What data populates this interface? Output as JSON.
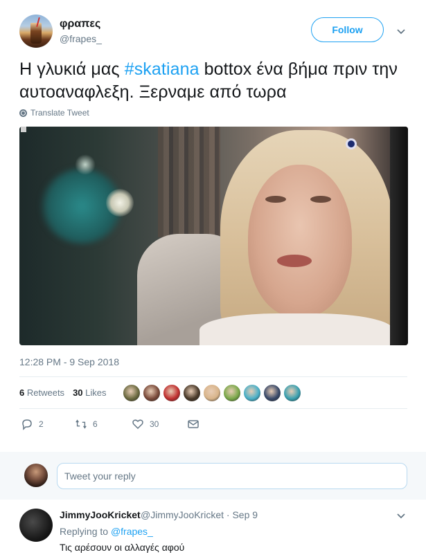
{
  "tweet": {
    "display_name": "φραπες",
    "handle": "@frapes_",
    "follow_label": "Follow",
    "text_before": "Η γλυκιά μας ",
    "hashtag": "#skatiana",
    "text_after": " bottox ένα βήμα πριν την αυτοαναφλεξη. Ξερναμε από τωρα",
    "translate_label": "Translate Tweet",
    "timestamp": "12:28 PM - 9 Sep 2018",
    "retweets_count": "6",
    "retweets_label": "Retweets",
    "likes_count": "30",
    "likes_label": "Likes",
    "reply_count": "2",
    "retweet_action_count": "6",
    "like_action_count": "30"
  },
  "liker_avatar_colors": [
    "#6b6a40",
    "#7a4a3a",
    "#c03030",
    "#4a3a2a",
    "#d8b48a",
    "#7aa84a",
    "#4ab0c8",
    "#3a4a6a",
    "#3aa0b0"
  ],
  "reply_box": {
    "placeholder": "Tweet your reply"
  },
  "reply": {
    "name": "JimmyJooKricket",
    "meta": "@JimmyJooKricket · Sep 9",
    "replying_to_label": "Replying to",
    "replying_to_handle": "@frapes_",
    "text": "Τις αρέσουν οι αλλαγές αφού"
  },
  "colors": {
    "accent": "#1da1f2",
    "secondary_text": "#657786",
    "primary_text": "#14171a"
  }
}
